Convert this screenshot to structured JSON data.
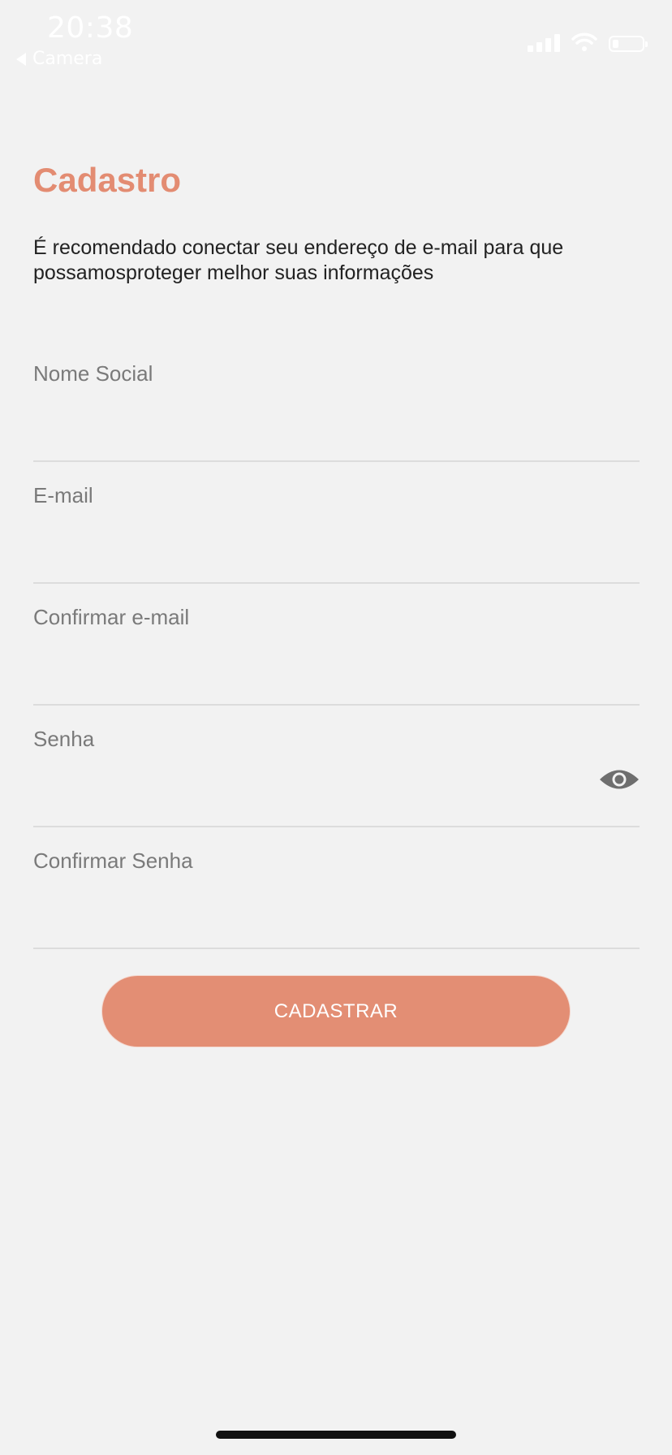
{
  "status_bar": {
    "time": "20:38",
    "back_app": "Camera"
  },
  "page": {
    "title": "Cadastro",
    "subtitle": "É recomendado conectar seu endereço de e-mail para que possamosproteger melhor suas informações"
  },
  "form": {
    "fields": [
      {
        "label": "Nome Social",
        "value": ""
      },
      {
        "label": "E-mail",
        "value": ""
      },
      {
        "label": "Confirmar e-mail",
        "value": ""
      },
      {
        "label": "Senha",
        "value": ""
      },
      {
        "label": "Confirmar Senha",
        "value": ""
      }
    ],
    "submit_label": "CADASTRAR"
  },
  "icons": {
    "password_toggle": "eye-icon",
    "back": "back-arrow-icon",
    "signal": "cellular-signal-icon",
    "wifi": "wifi-icon",
    "battery": "battery-icon"
  },
  "colors": {
    "accent": "#e38c72",
    "background": "#f2f2f2",
    "button": "#e38e74",
    "label": "#7a7a7a",
    "divider": "#dcdcdc"
  },
  "battery_level": 0.2
}
